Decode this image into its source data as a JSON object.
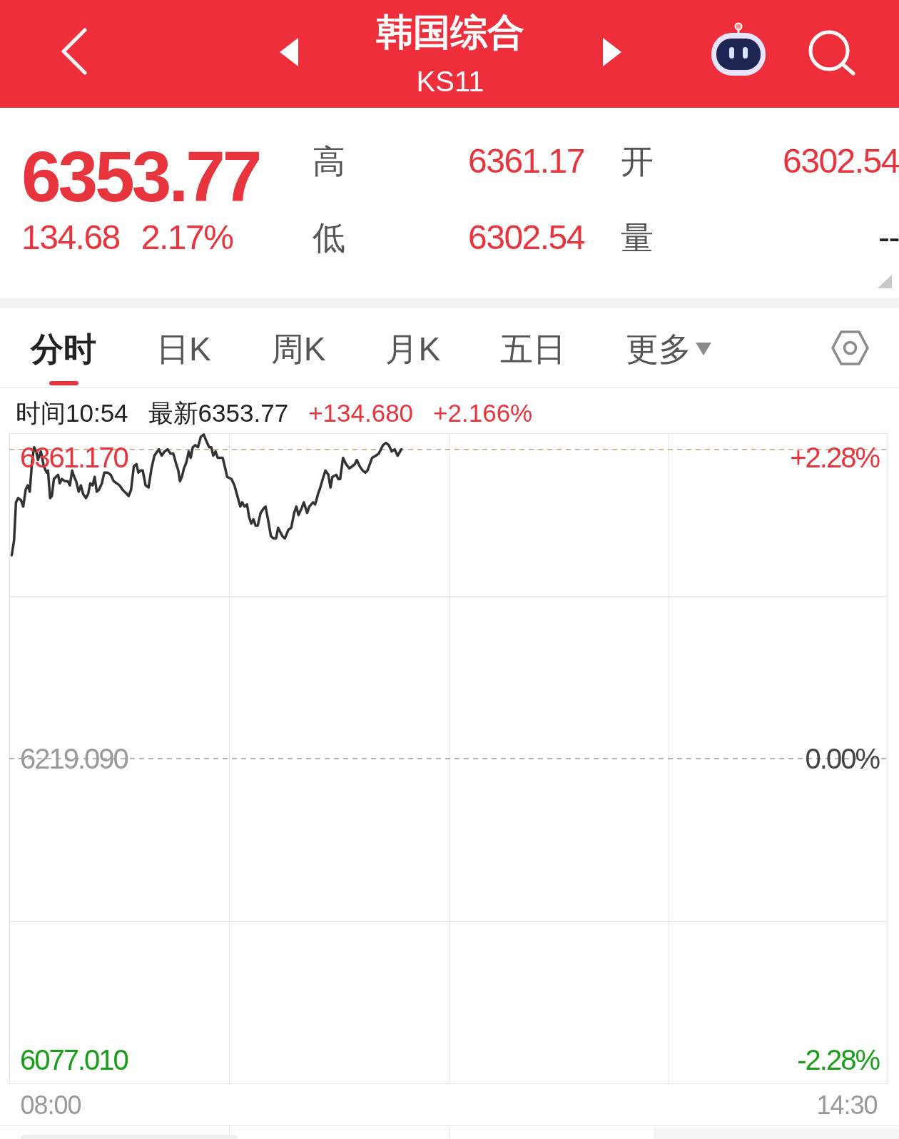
{
  "header": {
    "title": "韩国综合",
    "code": "KS11"
  },
  "quote": {
    "price": "6353.77",
    "change": "134.68",
    "change_percent": "2.17%",
    "color": "#e8343d"
  },
  "stats": [
    {
      "label": "高",
      "value": "6361.17",
      "color": "#e8343d"
    },
    {
      "label": "开",
      "value": "6302.54",
      "color": "#e8343d"
    },
    {
      "label": "低",
      "value": "6302.54",
      "color": "#e8343d"
    },
    {
      "label": "量",
      "value": "--",
      "color": "#222222"
    }
  ],
  "tabs": [
    {
      "label": "分时",
      "selected": true,
      "kind": "plain"
    },
    {
      "label": "日K",
      "selected": false,
      "kind": "plain"
    },
    {
      "label": "周K",
      "selected": false,
      "kind": "plain"
    },
    {
      "label": "月K",
      "selected": false,
      "kind": "plain"
    },
    {
      "label": "五日",
      "selected": false,
      "kind": "plain"
    },
    {
      "label": "更多",
      "selected": false,
      "kind": "dropdown"
    }
  ],
  "crosshair": [
    {
      "text": "时间10:54",
      "color": "#222222"
    },
    {
      "text": "最新6353.77",
      "color": "#222222"
    },
    {
      "text": "+134.680",
      "color": "#e8343d"
    },
    {
      "text": "+2.166%",
      "color": "#e8343d"
    }
  ],
  "chart": {
    "chart_data": {
      "type": "line",
      "x": [
        7.682,
        7.701,
        7.717,
        7.734,
        7.758,
        7.776,
        7.796,
        7.813,
        7.829,
        7.848,
        7.864,
        7.883,
        7.896,
        7.92,
        7.944,
        7.967,
        7.978,
        7.995,
        8.01,
        8.026,
        8.043,
        8.061,
        8.074,
        8.091,
        8.115,
        8.139,
        8.157,
        8.175,
        8.192,
        8.208,
        8.229,
        8.247,
        8.264,
        8.288,
        8.306,
        8.323,
        8.343,
        8.359,
        8.376,
        8.394,
        8.418,
        8.437,
        8.466,
        8.49,
        8.514,
        8.538,
        8.562,
        8.586,
        8.621,
        8.637,
        8.656,
        8.679,
        8.7,
        8.716,
        8.733,
        8.751,
        8.775,
        8.799,
        8.823,
        8.847,
        8.882,
        8.906,
        8.93,
        8.954,
        8.978,
        9.001,
        9.025,
        9.042,
        9.055,
        9.071,
        9.088,
        9.108,
        9.127,
        9.143,
        9.16,
        9.18,
        9.202,
        9.226,
        9.25,
        9.27,
        9.294,
        9.311,
        9.327,
        9.346,
        9.364,
        9.38,
        9.404,
        9.425,
        9.441,
        9.476,
        9.5,
        9.524,
        9.548,
        9.564,
        9.583,
        9.603,
        9.62,
        9.638,
        9.655,
        9.673,
        9.69,
        9.714,
        9.737,
        9.754,
        9.774,
        9.798,
        9.82,
        9.84,
        9.857,
        9.874,
        9.892,
        9.912,
        9.94,
        9.964,
        9.988,
        10.006,
        10.023,
        10.047,
        10.067,
        10.083,
        10.094,
        10.111,
        10.142,
        10.159,
        10.183,
        10.201,
        10.221,
        10.243,
        10.267,
        10.284,
        10.3,
        10.332,
        10.348,
        10.363,
        10.387,
        10.411,
        10.438,
        10.462,
        10.483,
        10.499,
        10.523,
        10.547,
        10.569,
        10.586,
        10.624,
        10.654,
        10.678,
        10.713,
        10.737,
        10.76,
        10.784,
        10.808,
        10.832,
        10.863
      ],
      "series": [
        {
          "color": "#333333",
          "values": [
            6315,
            6322,
            6340,
            6342,
            6341,
            6338,
            6346,
            6348,
            6345,
            6359,
            6366,
            6364,
            6360,
            6364,
            6357,
            6354,
            6355,
            6342,
            6343,
            6351,
            6352,
            6353,
            6349,
            6351,
            6350,
            6350,
            6348,
            6355,
            6352,
            6350,
            6345,
            6348,
            6344,
            6342,
            6344,
            6349,
            6348,
            6352,
            6345,
            6346,
            6349,
            6354,
            6354,
            6353,
            6350,
            6349,
            6348,
            6346,
            6344,
            6343,
            6346,
            6357,
            6358,
            6354,
            6355,
            6355,
            6348,
            6347,
            6356,
            6362,
            6365,
            6362,
            6364,
            6365,
            6363,
            6363,
            6358,
            6355,
            6350,
            6352,
            6356,
            6359,
            6364,
            6361,
            6366,
            6367,
            6366,
            6371,
            6372,
            6369,
            6366,
            6366,
            6362,
            6364,
            6361,
            6361,
            6361,
            6356,
            6352,
            6351,
            6348,
            6343,
            6338,
            6340,
            6338,
            6339,
            6333,
            6330,
            6332,
            6329,
            6329,
            6335,
            6337,
            6338,
            6332,
            6324,
            6323,
            6323,
            6328,
            6326,
            6324,
            6323,
            6327,
            6328,
            6335,
            6338,
            6334,
            6337,
            6340,
            6337,
            6335,
            6338,
            6340,
            6339,
            6344,
            6347,
            6351,
            6355,
            6353,
            6347,
            6352,
            6353,
            6351,
            6351,
            6361,
            6358,
            6356,
            6357,
            6358,
            6360,
            6357,
            6355,
            6354,
            6355,
            6361,
            6362,
            6363,
            6367,
            6368,
            6367,
            6364,
            6365,
            6362,
            6365
          ]
        }
      ],
      "xlim": [
        7.662,
        14.838
      ],
      "ylim": [
        6065.56,
        6372.62
      ],
      "xticks": [
        {
          "value": 8,
          "label": "08:00"
        },
        {
          "value": 14.5,
          "label": "14:30"
        }
      ],
      "yticks": [
        {
          "value": 6361.17,
          "label": "6361.170"
        },
        {
          "value": 6219.09,
          "label": "6219.090"
        },
        {
          "value": 6077.01,
          "label": "6077.010"
        }
      ],
      "ref_lines": [
        {
          "axis": "y",
          "value": 6365,
          "color": "#c9a57c"
        }
      ]
    },
    "percent_labels": [
      {
        "text": "+2.28%",
        "color": "#e8343d"
      },
      {
        "text": "0.00%",
        "color": "#444444"
      },
      {
        "text": "-2.28%",
        "color": "#17a017"
      }
    ]
  }
}
